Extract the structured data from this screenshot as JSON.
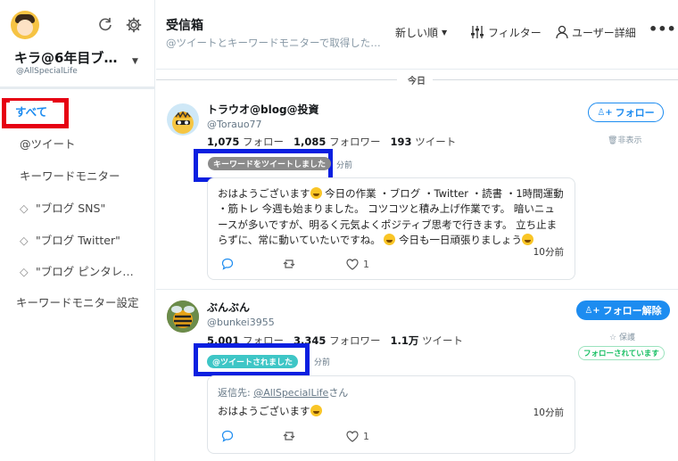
{
  "account": {
    "name": "キラ@6年目ブ…",
    "handle": "@AllSpecialLife"
  },
  "nav": {
    "active": "すべて",
    "items": [
      {
        "label": "@ツイート"
      },
      {
        "label": "キーワードモニター"
      },
      {
        "label": "\"ブログ SNS\""
      },
      {
        "label": "\"ブログ Twitter\""
      },
      {
        "label": "\"ブログ ピンタレ…"
      },
      {
        "label": "キーワードモニター設定"
      }
    ]
  },
  "header": {
    "title": "受信箱",
    "subtitle": "@ツイートとキーワードモニターで取得した…",
    "sort_label": "新しい順",
    "filter_label": "フィルター",
    "user_detail_label": "ユーザー詳細"
  },
  "day_divider": "今日",
  "tweets": [
    {
      "name": "トラウオ@blog@投資",
      "handle": "@Torauo77",
      "following": "1,075",
      "following_label": "フォロー",
      "followers": "1,085",
      "followers_label": "フォロワー",
      "tweets_count": "193",
      "tweets_label": "ツイート",
      "badge": "キーワードをツイートしました",
      "badge_color": "#8b8b8b",
      "badge_time": "分前",
      "reply_to_label": "",
      "reply_to": "",
      "reply_suffix": "",
      "lines": [
        "おはようございます",
        " 今日の作業 ・ブログ ・Twitter ・読書 ・1時間運動",
        "・筋トレ 今週も始まりました。 コツコツと積み上げ作業です。 暗いニュ",
        "ースが多いですが、明るく元気よくポジティブ思考で行きます。 立ち止ま",
        "らずに、常に動いていたいですね。",
        " 今日も一日頑張りましょう"
      ],
      "time": "10分前",
      "likes": "1",
      "follow_label": "フォロー",
      "side_link": "非表示",
      "side_badge": ""
    },
    {
      "name": "ぶんぶん",
      "handle": "@bunkei3955",
      "following": "5,001",
      "following_label": "フォロー",
      "followers": "3,345",
      "followers_label": "フォロワー",
      "tweets_count": "1.1万",
      "tweets_label": "ツイート",
      "badge": "@ツイートされました",
      "badge_color": "#3ec6c6",
      "badge_time": "分前",
      "reply_to_label": "返信先: ",
      "reply_to": "@AllSpecialLife",
      "reply_suffix": "さん",
      "lines": [
        "おはようございます"
      ],
      "time": "10分前",
      "likes": "1",
      "follow_label": "フォロー解除",
      "side_link": "保護",
      "side_badge": "フォローされています"
    }
  ],
  "colors": {
    "accent": "#1d8cf0",
    "annotation_red": "#e60012",
    "annotation_blue": "#0a1fe0"
  }
}
